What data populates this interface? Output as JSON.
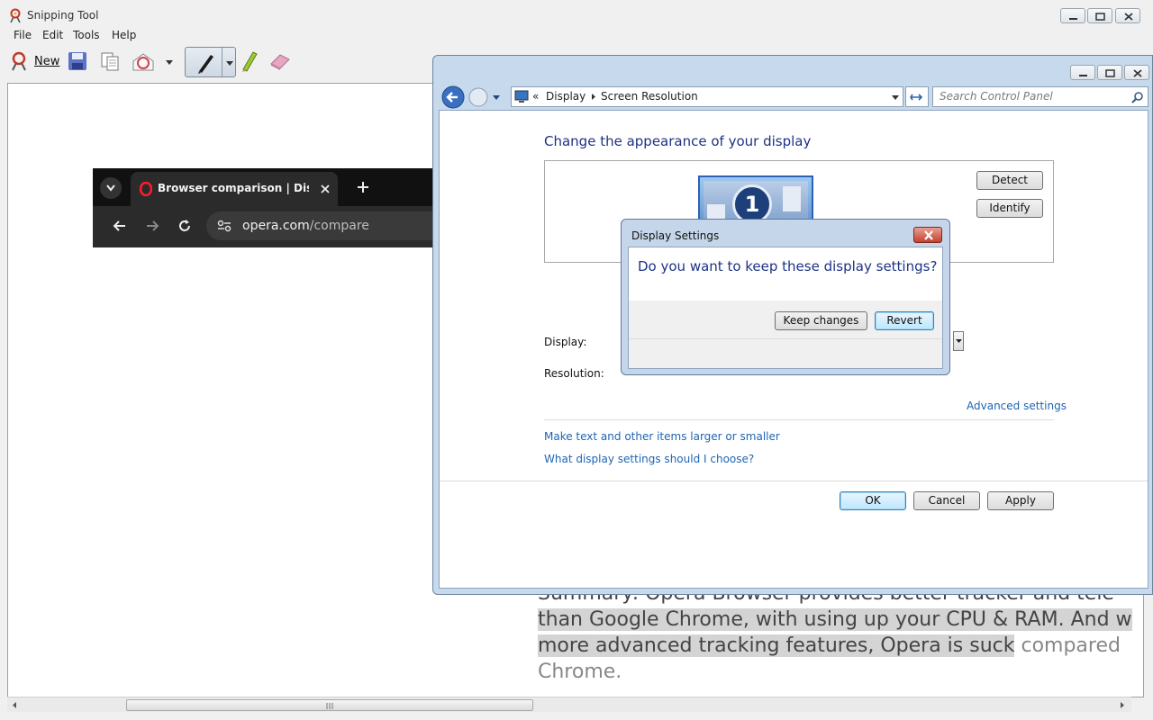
{
  "snipping_tool": {
    "title": "Snipping Tool",
    "menu": [
      "File",
      "Edit",
      "Tools",
      "Help"
    ],
    "toolbar": {
      "new_label": "New"
    }
  },
  "captured_browser": {
    "tab_title": "Browser comparison | Discover",
    "url_host": "opera.com",
    "url_path": "/compare"
  },
  "summary_text": {
    "line1": "Summary: Opera Browser provides better tracker and tele",
    "line2": "than Google Chrome, with using up your CPU & RAM. And w",
    "line3_hl": "more advanced tracking features, Opera is suck",
    "line3_rest": " compared",
    "line4": "Chrome."
  },
  "control_panel": {
    "breadcrumb": [
      "Display",
      "Screen Resolution"
    ],
    "breadcrumb_prefix": "«",
    "search_placeholder": "Search Control Panel",
    "heading": "Change the appearance of your display",
    "monitor_number": "1",
    "detect_label": "Detect",
    "identify_label": "Identify",
    "display_label": "Display:",
    "resolution_label": "Resolution:",
    "advanced_link": "Advanced settings",
    "link1": "Make text and other items larger or smaller",
    "link2": "What display settings should I choose?",
    "ok_label": "OK",
    "cancel_label": "Cancel",
    "apply_label": "Apply"
  },
  "dialog": {
    "title": "Display Settings",
    "question": "Do you want to keep these display settings?",
    "keep_label": "Keep changes",
    "revert_label": "Revert"
  }
}
